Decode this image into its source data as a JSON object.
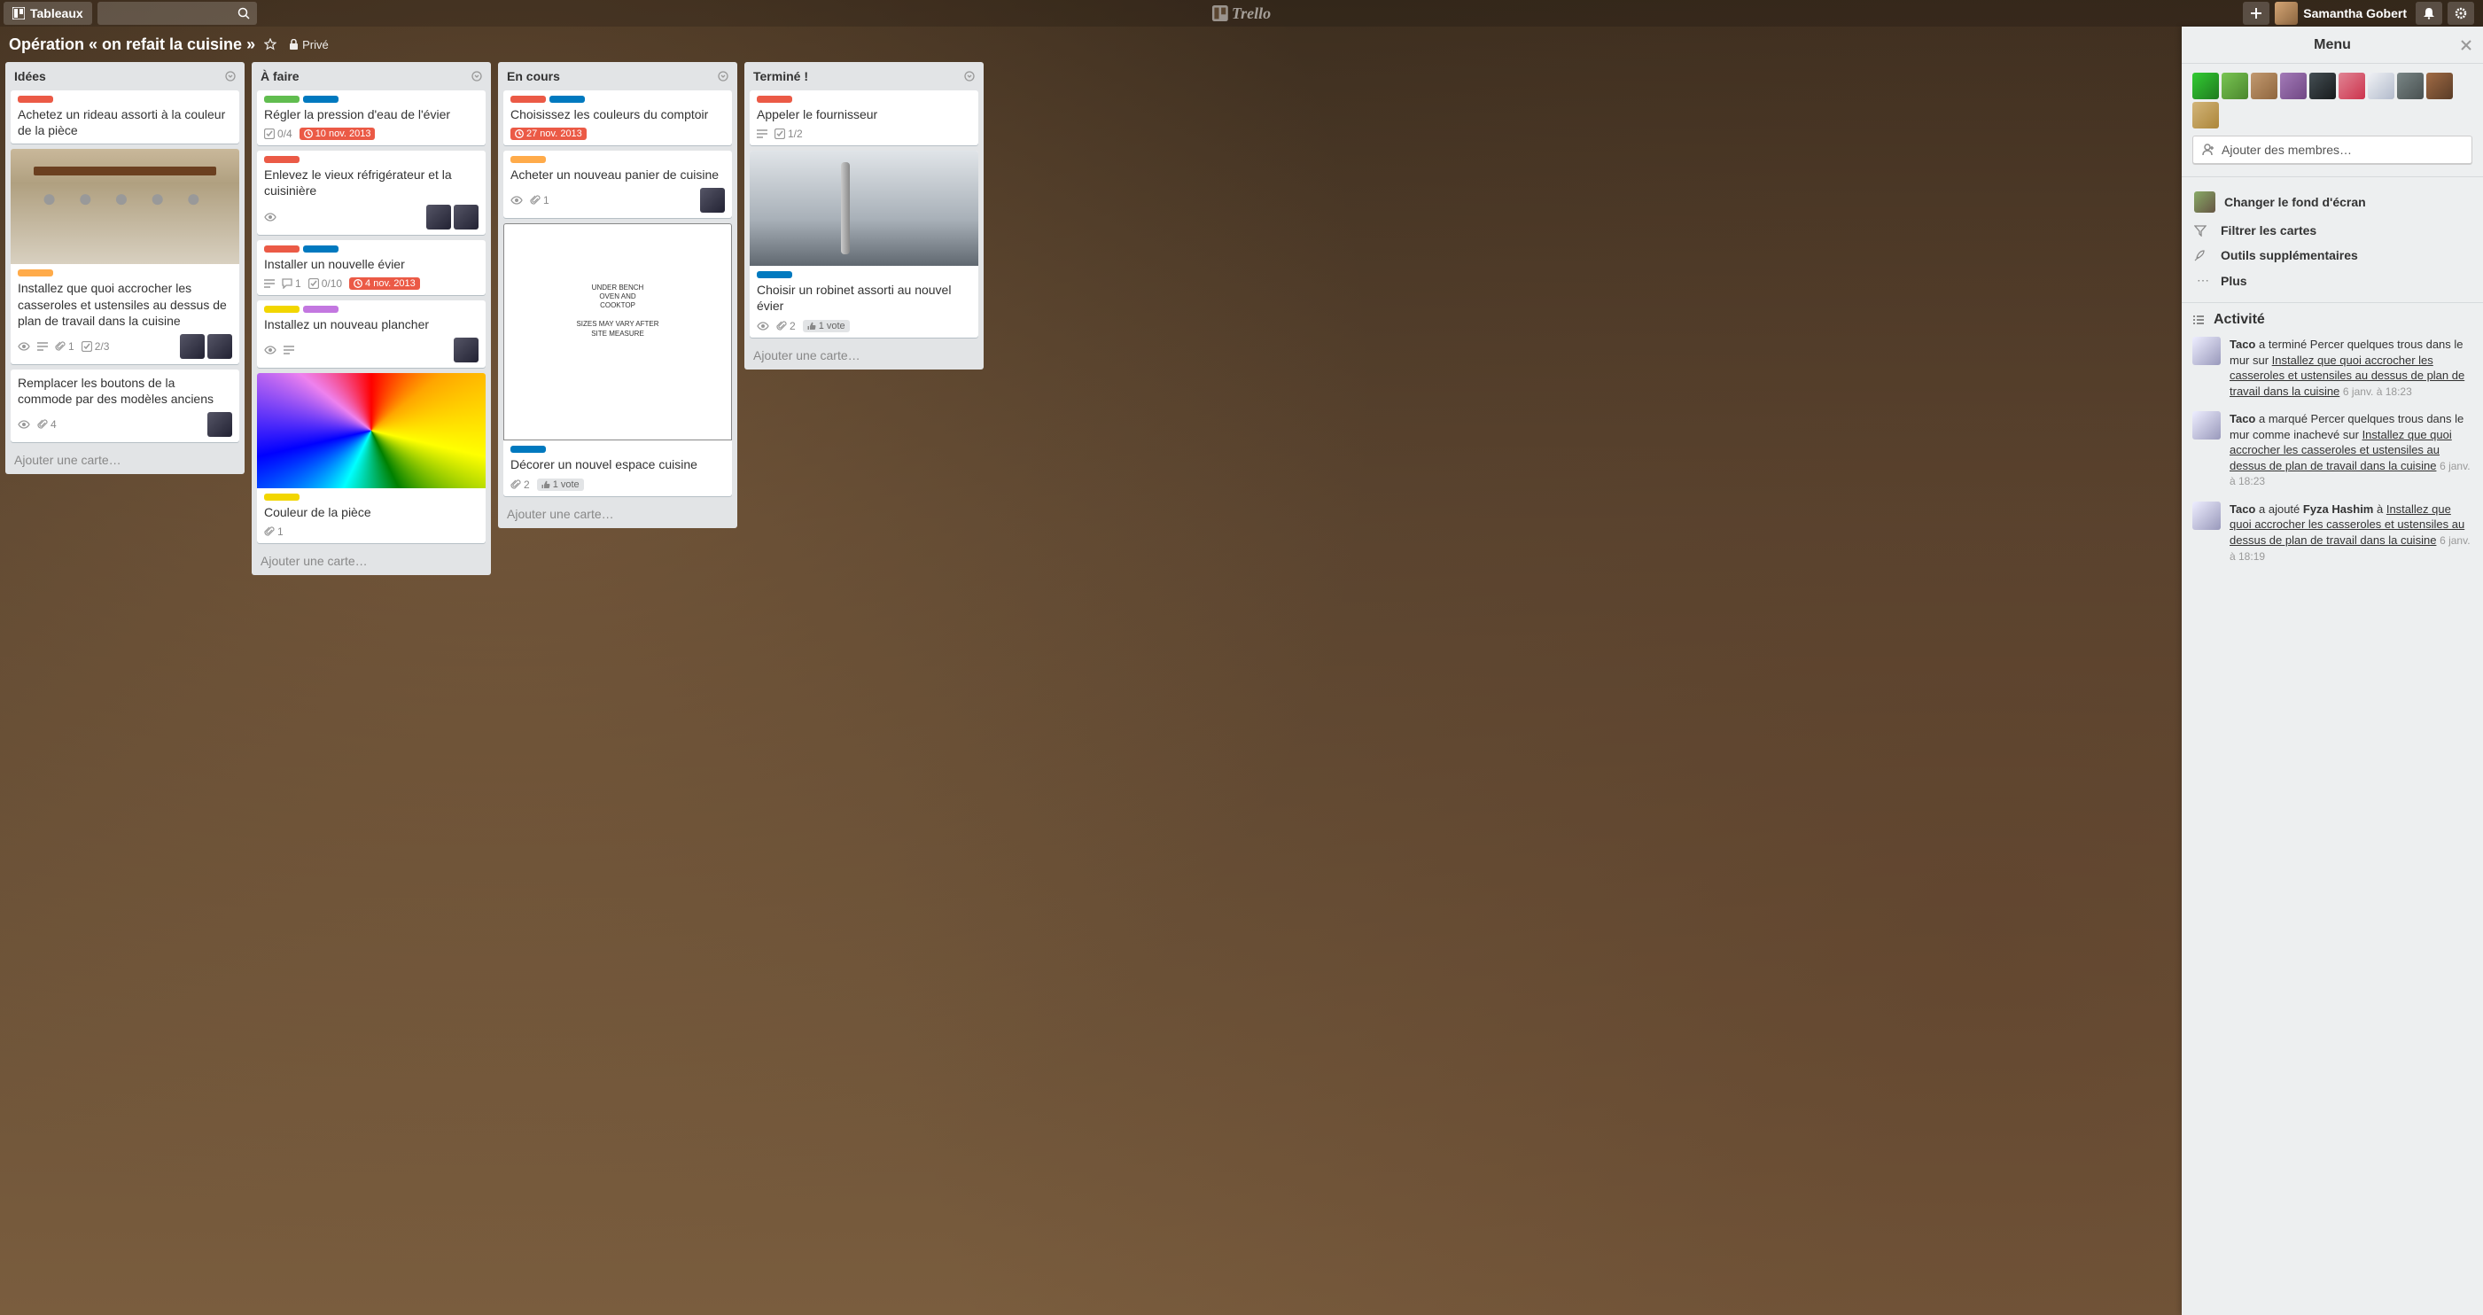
{
  "header": {
    "boards_btn": "Tableaux",
    "brand": "Trello",
    "username": "Samantha Gobert"
  },
  "board": {
    "title": "Opération « on refait la cuisine »",
    "privacy": "Privé"
  },
  "lists": [
    {
      "name": "Idées",
      "add_card": "Ajouter une carte…",
      "cards": [
        {
          "labels": [
            "red"
          ],
          "title": "Achetez un rideau assorti à la couleur de la pièce"
        },
        {
          "cover": "pots",
          "labels": [
            "orange"
          ],
          "title": "Installez que quoi accrocher les casseroles et ustensiles au dessus de plan de travail dans la cuisine",
          "badges": {
            "eye": true,
            "desc": true,
            "attach": "1",
            "check": "2/3"
          },
          "members": 2
        },
        {
          "title": "Remplacer les boutons de la commode par des modèles anciens",
          "badges": {
            "eye": true,
            "attach": "4"
          },
          "members": 1
        }
      ]
    },
    {
      "name": "À faire",
      "add_card": "Ajouter une carte…",
      "cards": [
        {
          "labels": [
            "green",
            "blue"
          ],
          "title": "Régler la pression d'eau de l'évier",
          "badges": {
            "check": "0/4",
            "due": "10 nov. 2013"
          }
        },
        {
          "labels": [
            "red"
          ],
          "title": "Enlevez le vieux réfrigérateur et la cuisinière",
          "badges": {
            "eye": true
          },
          "members": 2
        },
        {
          "labels": [
            "red",
            "blue"
          ],
          "title": "Installer un nouvelle évier",
          "badges": {
            "desc": true,
            "comments": "1",
            "check": "0/10",
            "due": "4 nov. 2013"
          }
        },
        {
          "labels": [
            "yellow",
            "purple"
          ],
          "title": "Installez un nouveau plancher",
          "badges": {
            "desc": true,
            "eye": true
          },
          "members": 1
        },
        {
          "cover": "colorwheel",
          "labels": [
            "yellow"
          ],
          "title": "Couleur de la pièce",
          "badges": {
            "attach": "1"
          }
        }
      ]
    },
    {
      "name": "En cours",
      "add_card": "Ajouter une carte…",
      "cards": [
        {
          "labels": [
            "red",
            "blue"
          ],
          "title": "Choisissez les couleurs du comptoir",
          "badges": {
            "due": "27 nov. 2013"
          }
        },
        {
          "labels": [
            "orange"
          ],
          "title": "Acheter un nouveau panier de cuisine",
          "badges": {
            "eye": true,
            "attach": "1"
          },
          "members": 1
        },
        {
          "cover": "plan",
          "labels": [
            "blue"
          ],
          "title": "Décorer un nouvel espace cuisine",
          "badges": {
            "vote": "1 vote",
            "attach": "2"
          }
        }
      ]
    },
    {
      "name": "Terminé !",
      "add_card": "Ajouter une carte…",
      "cards": [
        {
          "labels": [
            "red"
          ],
          "title": "Appeler le fournisseur",
          "badges": {
            "desc": true,
            "check": "1/2"
          }
        },
        {
          "cover": "faucet",
          "labels": [
            "blue"
          ],
          "title": "Choisir un robinet assorti au nouvel évier",
          "badges": {
            "eye": true,
            "vote": "1 vote",
            "attach": "2"
          }
        }
      ]
    }
  ],
  "menu": {
    "title": "Menu",
    "add_members": "Ajouter des membres…",
    "member_count": 10,
    "items": {
      "background": "Changer le fond d'écran",
      "filter": "Filtrer les cartes",
      "tools": "Outils supplémentaires",
      "more": "Plus"
    },
    "activity_title": "Activité",
    "activity": [
      {
        "actor": "Taco",
        "text1": " a terminé Percer quelques trous dans le mur sur ",
        "link": "Installez que quoi accrocher les casseroles et ustensiles au dessus de plan de travail dans la cuisine",
        "time": "6 janv. à 18:23"
      },
      {
        "actor": "Taco",
        "text1": " a marqué Percer quelques trous dans le mur comme inachevé sur ",
        "link": "Installez que quoi accrocher les casseroles et ustensiles au dessus de plan de travail dans la cuisine",
        "time": "6 janv. à 18:23"
      },
      {
        "actor": "Taco",
        "text1": " a ajouté ",
        "bold2": "Fyza Hashim",
        "text2": " à ",
        "link": "Installez que quoi accrocher les casseroles et ustensiles au dessus de plan de travail dans la cuisine",
        "time": "6 janv. à 18:19"
      }
    ]
  }
}
